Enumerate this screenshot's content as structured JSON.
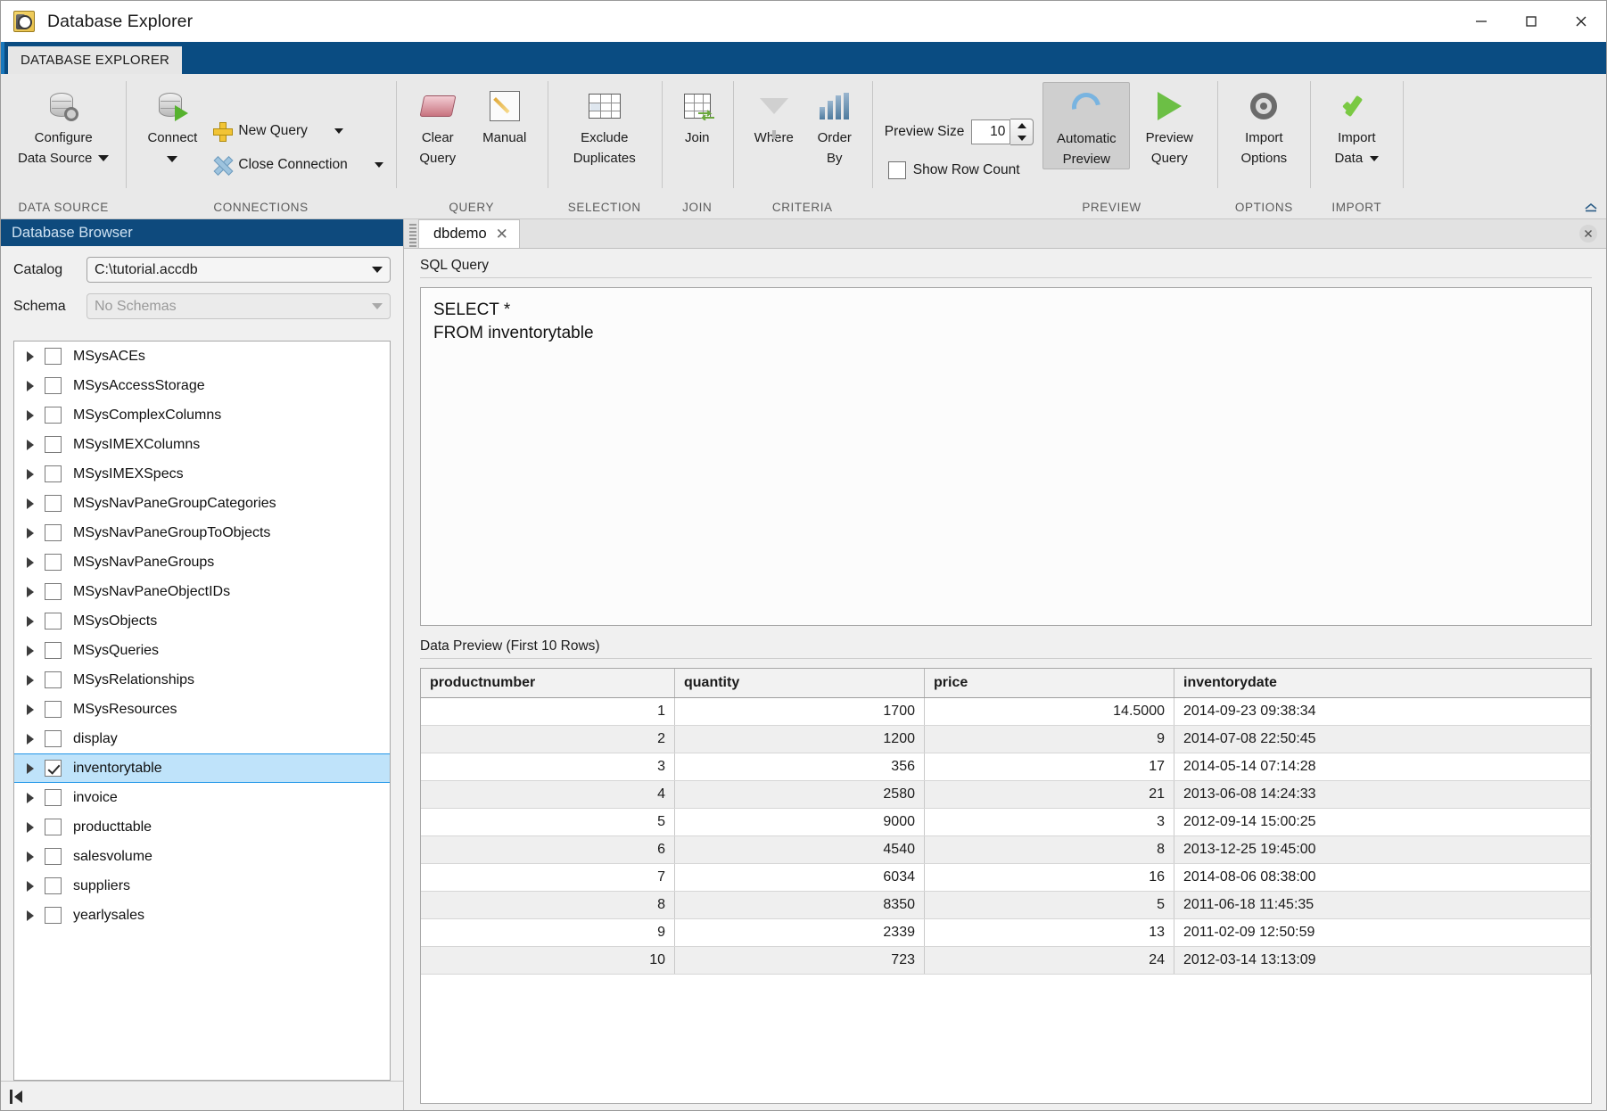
{
  "window": {
    "title": "Database Explorer",
    "icon": "database-explorer-icon",
    "minimize_label": "—",
    "maximize_label": "□",
    "close_label": "✕"
  },
  "ribbon": {
    "tab_label": "DATABASE EXPLORER",
    "groups": [
      {
        "label": "DATA SOURCE",
        "buttons": [
          {
            "name": "configure-data-source",
            "line1": "Configure",
            "line2": "Data Source",
            "has_caret": true
          }
        ]
      },
      {
        "label": "CONNECTIONS",
        "buttons": [
          {
            "name": "connect",
            "line1": "Connect",
            "line2": "",
            "has_caret": true
          }
        ],
        "small_items": [
          {
            "name": "new-query",
            "label": "New Query",
            "icon": "plus-icon",
            "has_caret": true
          },
          {
            "name": "close-connection",
            "label": "Close Connection",
            "icon": "x-icon",
            "has_caret": true
          }
        ]
      },
      {
        "label": "QUERY",
        "buttons": [
          {
            "name": "clear-query",
            "line1": "Clear",
            "line2": "Query",
            "has_caret": false
          },
          {
            "name": "manual",
            "line1": "Manual",
            "line2": "",
            "has_caret": false
          }
        ]
      },
      {
        "label": "SELECTION",
        "buttons": [
          {
            "name": "exclude-duplicates",
            "line1": "Exclude",
            "line2": "Duplicates",
            "has_caret": false
          }
        ]
      },
      {
        "label": "JOIN",
        "buttons": [
          {
            "name": "join",
            "line1": "Join",
            "line2": "",
            "has_caret": false
          }
        ]
      },
      {
        "label": "CRITERIA",
        "buttons": [
          {
            "name": "where",
            "line1": "Where",
            "line2": "",
            "has_caret": false
          },
          {
            "name": "order-by",
            "line1": "Order",
            "line2": "By",
            "has_caret": false
          }
        ]
      },
      {
        "label": "PREVIEW",
        "preview_size_label": "Preview Size",
        "preview_size_value": "10",
        "show_row_count_label": "Show Row Count",
        "show_row_count_checked": false,
        "buttons": [
          {
            "name": "automatic-preview",
            "line1": "Automatic",
            "line2": "Preview",
            "active": true
          },
          {
            "name": "preview-query",
            "line1": "Preview",
            "line2": "Query",
            "active": false
          }
        ]
      },
      {
        "label": "OPTIONS",
        "buttons": [
          {
            "name": "import-options",
            "line1": "Import",
            "line2": "Options",
            "has_caret": false
          }
        ]
      },
      {
        "label": "IMPORT",
        "buttons": [
          {
            "name": "import-data",
            "line1": "Import",
            "line2": "Data",
            "has_caret": true
          }
        ]
      }
    ]
  },
  "browser": {
    "panel_title": "Database Browser",
    "catalog_label": "Catalog",
    "catalog_value": "C:\\tutorial.accdb",
    "schema_label": "Schema",
    "schema_value": "No Schemas",
    "tables": [
      {
        "name": "MSysACEs",
        "checked": false,
        "selected": false
      },
      {
        "name": "MSysAccessStorage",
        "checked": false,
        "selected": false
      },
      {
        "name": "MSysComplexColumns",
        "checked": false,
        "selected": false
      },
      {
        "name": "MSysIMEXColumns",
        "checked": false,
        "selected": false
      },
      {
        "name": "MSysIMEXSpecs",
        "checked": false,
        "selected": false
      },
      {
        "name": "MSysNavPaneGroupCategories",
        "checked": false,
        "selected": false
      },
      {
        "name": "MSysNavPaneGroupToObjects",
        "checked": false,
        "selected": false
      },
      {
        "name": "MSysNavPaneGroups",
        "checked": false,
        "selected": false
      },
      {
        "name": "MSysNavPaneObjectIDs",
        "checked": false,
        "selected": false
      },
      {
        "name": "MSysObjects",
        "checked": false,
        "selected": false
      },
      {
        "name": "MSysQueries",
        "checked": false,
        "selected": false
      },
      {
        "name": "MSysRelationships",
        "checked": false,
        "selected": false
      },
      {
        "name": "MSysResources",
        "checked": false,
        "selected": false
      },
      {
        "name": "display",
        "checked": false,
        "selected": false
      },
      {
        "name": "inventorytable",
        "checked": true,
        "selected": true
      },
      {
        "name": "invoice",
        "checked": false,
        "selected": false
      },
      {
        "name": "producttable",
        "checked": false,
        "selected": false
      },
      {
        "name": "salesvolume",
        "checked": false,
        "selected": false
      },
      {
        "name": "suppliers",
        "checked": false,
        "selected": false
      },
      {
        "name": "yearlysales",
        "checked": false,
        "selected": false
      }
    ]
  },
  "document": {
    "tab_label": "dbdemo",
    "tab_close": "✕",
    "sql_query_label": "SQL Query",
    "sql_text": "SELECT *\nFROM inventorytable",
    "data_preview_label": "Data Preview (First 10 Rows)",
    "columns": [
      "productnumber",
      "quantity",
      "price",
      "inventorydate"
    ],
    "rows": [
      [
        "1",
        "1700",
        "14.5000",
        "2014-09-23 09:38:34"
      ],
      [
        "2",
        "1200",
        "9",
        "2014-07-08 22:50:45"
      ],
      [
        "3",
        "356",
        "17",
        "2014-05-14 07:14:28"
      ],
      [
        "4",
        "2580",
        "21",
        "2013-06-08 14:24:33"
      ],
      [
        "5",
        "9000",
        "3",
        "2012-09-14 15:00:25"
      ],
      [
        "6",
        "4540",
        "8",
        "2013-12-25 19:45:00"
      ],
      [
        "7",
        "6034",
        "16",
        "2014-08-06 08:38:00"
      ],
      [
        "8",
        "8350",
        "5",
        "2011-06-18 11:45:35"
      ],
      [
        "9",
        "2339",
        "13",
        "2011-02-09 12:50:59"
      ],
      [
        "10",
        "723",
        "24",
        "2012-03-14 13:13:09"
      ]
    ]
  },
  "colors": {
    "accent_blue": "#0a4c82",
    "panel_header": "#0e4a7d",
    "selection": "#bfe3fa",
    "selection_border": "#2196e8",
    "ribbon_bg": "#e9e9e9"
  }
}
